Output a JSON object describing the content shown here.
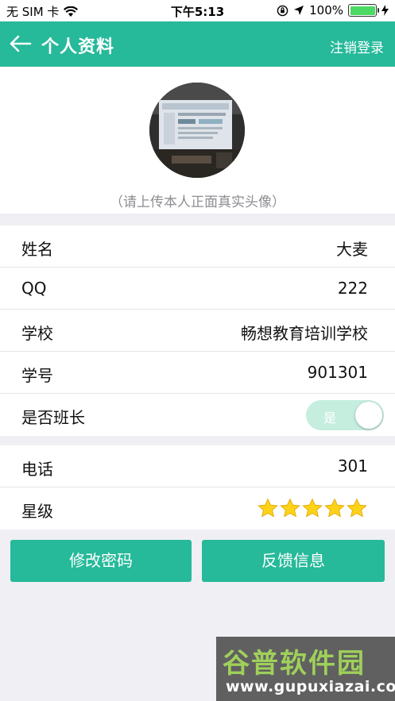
{
  "status_bar": {
    "carrier": "无 SIM 卡",
    "time": "下午5:13",
    "battery": "100%"
  },
  "navbar": {
    "title": "个人资料",
    "logout": "注销登录"
  },
  "avatar": {
    "hint": "（请上传本人正面真实头像）"
  },
  "profile": {
    "name_label": "姓名",
    "name_value": "大麦",
    "qq_label": "QQ",
    "qq_value": "222",
    "school_label": "学校",
    "school_value": "畅想教育培训学校",
    "student_no_label": "学号",
    "student_no_value": "901301",
    "monitor_label": "是否班长",
    "monitor_toggle_text": "是"
  },
  "contact": {
    "phone_label": "电话",
    "phone_value": "301",
    "rating_label": "星级",
    "rating_stars": 5,
    "rating_max": 5
  },
  "buttons": {
    "change_password": "修改密码",
    "feedback": "反馈信息"
  },
  "watermark": {
    "title": "谷普软件园",
    "url": "www.gupuxiazai.com"
  },
  "colors": {
    "accent": "#26b99a",
    "background": "#efeff4",
    "toggle": "#c5eedf",
    "star": "#ffd21a"
  }
}
